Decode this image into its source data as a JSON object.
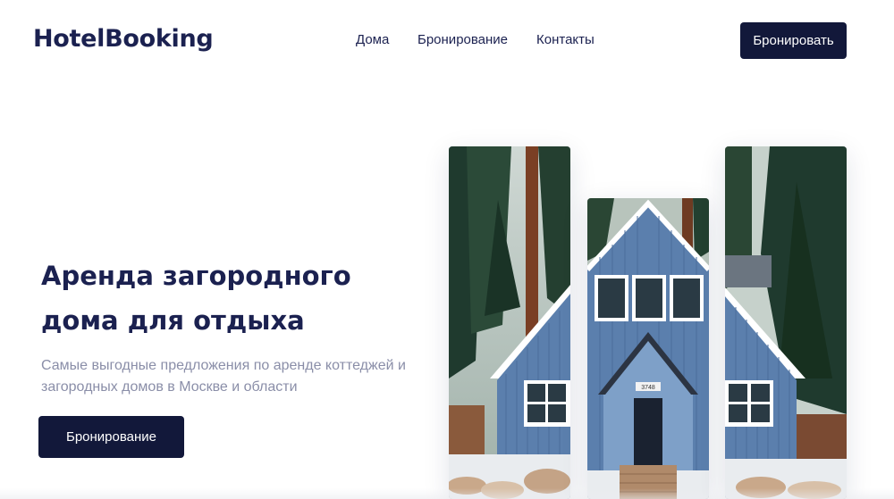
{
  "header": {
    "logo": "HotelBooking",
    "nav": [
      "Дома",
      "Бронирование",
      "Контакты"
    ],
    "cta": "Бронировать"
  },
  "hero": {
    "title": "Аренда загородного дома для отдыха",
    "subtitle": "Самые выгодные предложения по аренде коттеджей и загородных домов в Москве и области",
    "cta": "Бронирование"
  },
  "gallery": {
    "images": [
      "cabin-photo-left",
      "cabin-photo-center",
      "cabin-photo-right"
    ],
    "house_sign": "3748"
  },
  "colors": {
    "brand_navy": "#12183a",
    "text_primary": "#1b2150",
    "text_muted": "#8a8ea8",
    "house_blue": "#5b7fad"
  }
}
